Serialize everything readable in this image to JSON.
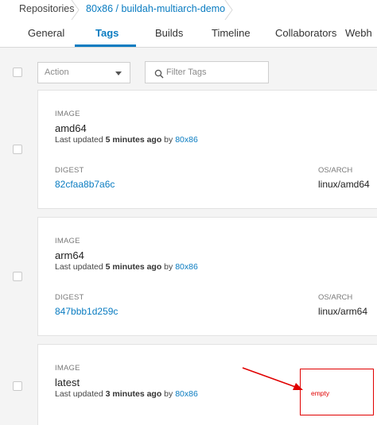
{
  "breadcrumb": {
    "repositories": "Repositories",
    "current": "80x86 / buildah-multiarch-demo"
  },
  "tabs": [
    "General",
    "Tags",
    "Builds",
    "Timeline",
    "Collaborators",
    "Webh"
  ],
  "active_tab": "Tags",
  "toolbar": {
    "action_label": "Action",
    "filter_placeholder": "Filter Tags"
  },
  "labels": {
    "image": "IMAGE",
    "digest": "DIGEST",
    "osarch": "OS/ARCH",
    "last_updated": "Last updated",
    "by": "by"
  },
  "tags": [
    {
      "name": "amd64",
      "updated_time": "5 minutes ago",
      "user": "80x86",
      "digest": "82cfaa8b7a6c",
      "osarch": "linux/amd64"
    },
    {
      "name": "arm64",
      "updated_time": "5 minutes ago",
      "user": "80x86",
      "digest": "847bbb1d259c",
      "osarch": "linux/arm64"
    },
    {
      "name": "latest",
      "updated_time": "3 minutes ago",
      "user": "80x86"
    }
  ],
  "annotation": {
    "text": "empty",
    "color": "#e00000"
  },
  "colors": {
    "accent": "#0a7cc1",
    "background": "#f4f4f4"
  }
}
